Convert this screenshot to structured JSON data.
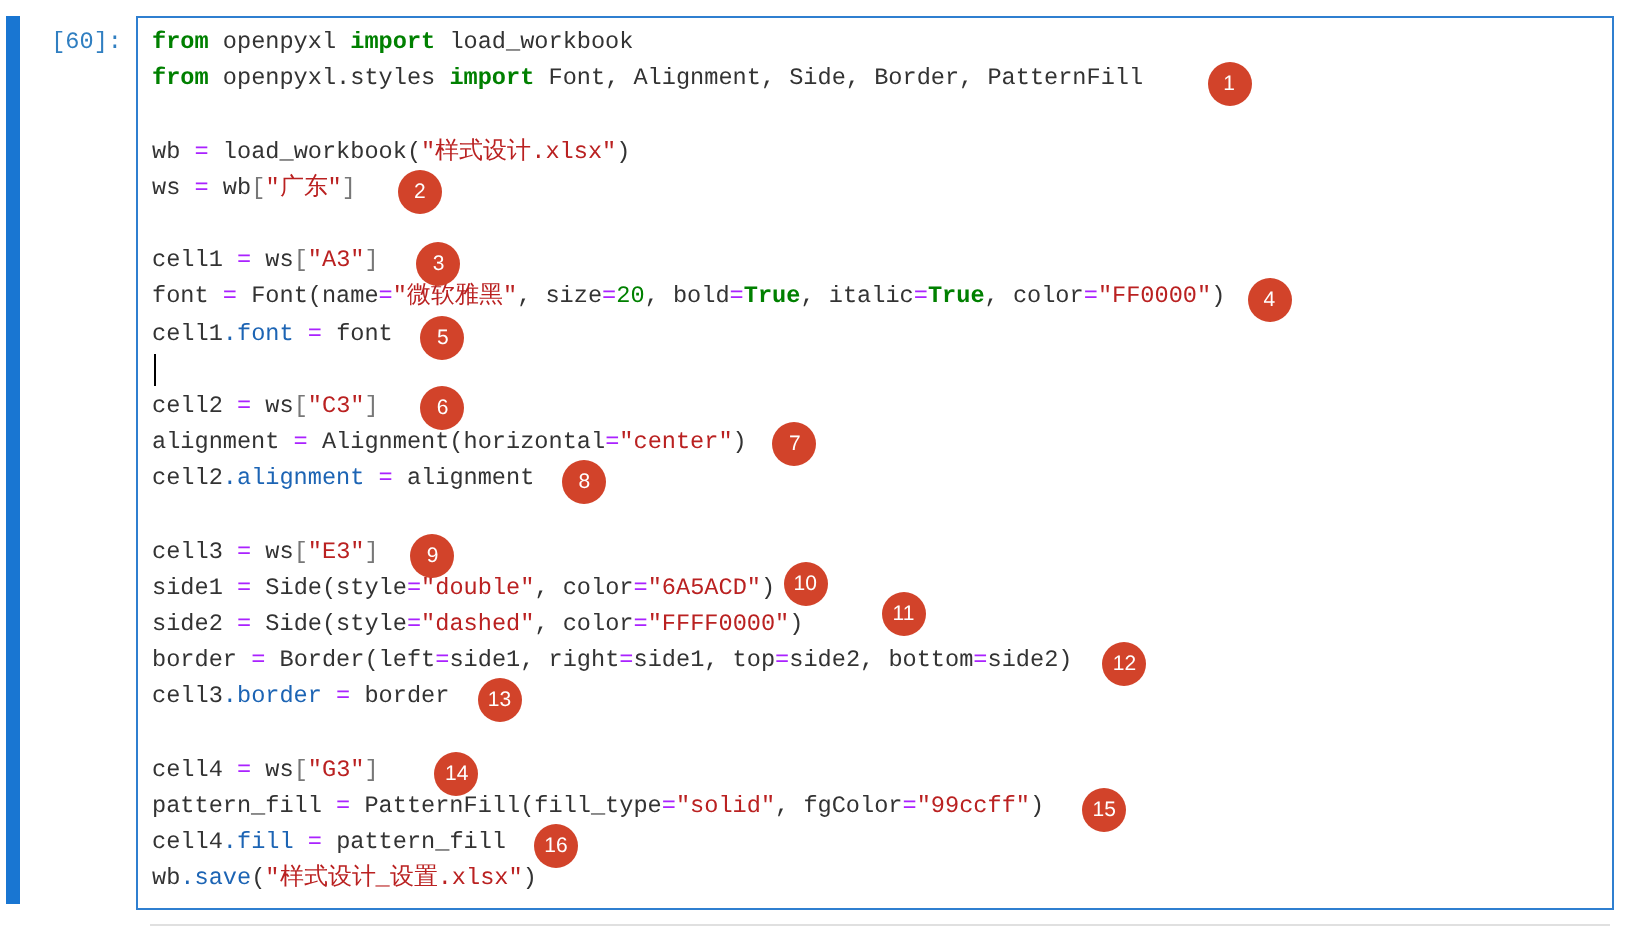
{
  "cell": {
    "prompt": "[60]:",
    "blocks": [
      {
        "lines": [
          {
            "tokens": [
              {
                "kind": "keyword",
                "text": "from"
              },
              {
                "kind": "plain",
                "text": " openpyxl "
              },
              {
                "kind": "keyword",
                "text": "import"
              },
              {
                "kind": "plain",
                "text": " load_workbook"
              }
            ]
          },
          {
            "tokens": [
              {
                "kind": "keyword",
                "text": "from"
              },
              {
                "kind": "plain",
                "text": " openpyxl.styles "
              },
              {
                "kind": "keyword",
                "text": "import"
              },
              {
                "kind": "plain",
                "text": " Font, Alignment, Side, Border, PatternFill"
              }
            ],
            "badge": "1"
          }
        ]
      },
      {
        "lines": [
          {
            "tokens": [
              {
                "kind": "plain",
                "text": "wb "
              },
              {
                "kind": "op",
                "text": "="
              },
              {
                "kind": "plain",
                "text": " load_workbook("
              },
              {
                "kind": "string",
                "text": "\"样式设计.xlsx\""
              },
              {
                "kind": "plain",
                "text": ")"
              }
            ]
          },
          {
            "tokens": [
              {
                "kind": "plain",
                "text": "ws "
              },
              {
                "kind": "op",
                "text": "="
              },
              {
                "kind": "plain",
                "text": " wb"
              },
              {
                "kind": "punct",
                "text": "["
              },
              {
                "kind": "string",
                "text": "\"广东\""
              },
              {
                "kind": "punct",
                "text": "]"
              }
            ],
            "badge": "2"
          }
        ]
      },
      {
        "lines": [
          {
            "tokens": [
              {
                "kind": "plain",
                "text": "cell1 "
              },
              {
                "kind": "op",
                "text": "="
              },
              {
                "kind": "plain",
                "text": " ws"
              },
              {
                "kind": "punct",
                "text": "["
              },
              {
                "kind": "string",
                "text": "\"A3\""
              },
              {
                "kind": "punct",
                "text": "]"
              }
            ],
            "badge": "3"
          },
          {
            "tokens": [
              {
                "kind": "plain",
                "text": "font "
              },
              {
                "kind": "op",
                "text": "="
              },
              {
                "kind": "plain",
                "text": " Font(name"
              },
              {
                "kind": "op",
                "text": "="
              },
              {
                "kind": "string",
                "text": "\"微软雅黑\""
              },
              {
                "kind": "plain",
                "text": ", size"
              },
              {
                "kind": "op",
                "text": "="
              },
              {
                "kind": "number",
                "text": "20"
              },
              {
                "kind": "plain",
                "text": ", bold"
              },
              {
                "kind": "op",
                "text": "="
              },
              {
                "kind": "keyword",
                "text": "True"
              },
              {
                "kind": "plain",
                "text": ", italic"
              },
              {
                "kind": "op",
                "text": "="
              },
              {
                "kind": "keyword",
                "text": "True"
              },
              {
                "kind": "plain",
                "text": ", color"
              },
              {
                "kind": "op",
                "text": "="
              },
              {
                "kind": "string",
                "text": "\"FF0000\""
              },
              {
                "kind": "plain",
                "text": ")"
              }
            ],
            "badge": "4"
          },
          {
            "tokens": [
              {
                "kind": "plain",
                "text": "cell1"
              },
              {
                "kind": "attr",
                "text": ".font"
              },
              {
                "kind": "op",
                "text": " = "
              },
              {
                "kind": "plain",
                "text": "font"
              }
            ],
            "badge": "5"
          },
          {
            "cursor": true
          }
        ]
      },
      {
        "lines": [
          {
            "tokens": [
              {
                "kind": "plain",
                "text": "cell2 "
              },
              {
                "kind": "op",
                "text": "="
              },
              {
                "kind": "plain",
                "text": " ws"
              },
              {
                "kind": "punct",
                "text": "["
              },
              {
                "kind": "string",
                "text": "\"C3\""
              },
              {
                "kind": "punct",
                "text": "]"
              }
            ],
            "badge": "6"
          },
          {
            "tokens": [
              {
                "kind": "plain",
                "text": "alignment "
              },
              {
                "kind": "op",
                "text": "="
              },
              {
                "kind": "plain",
                "text": " Alignment(horizontal"
              },
              {
                "kind": "op",
                "text": "="
              },
              {
                "kind": "string",
                "text": "\"center\""
              },
              {
                "kind": "plain",
                "text": ")"
              }
            ],
            "badge": "7"
          },
          {
            "tokens": [
              {
                "kind": "plain",
                "text": "cell2"
              },
              {
                "kind": "attr",
                "text": ".alignment"
              },
              {
                "kind": "op",
                "text": " = "
              },
              {
                "kind": "plain",
                "text": "alignment"
              }
            ],
            "badge": "8"
          }
        ]
      },
      {
        "lines": [
          {
            "tokens": [
              {
                "kind": "plain",
                "text": "cell3 "
              },
              {
                "kind": "op",
                "text": "="
              },
              {
                "kind": "plain",
                "text": " ws"
              },
              {
                "kind": "punct",
                "text": "["
              },
              {
                "kind": "string",
                "text": "\"E3\""
              },
              {
                "kind": "punct",
                "text": "]"
              }
            ],
            "badge": "9"
          },
          {
            "tokens": [
              {
                "kind": "plain",
                "text": "side1 "
              },
              {
                "kind": "op",
                "text": "="
              },
              {
                "kind": "plain",
                "text": " Side(style"
              },
              {
                "kind": "op",
                "text": "="
              },
              {
                "kind": "string",
                "text": "\"double\""
              },
              {
                "kind": "plain",
                "text": ", color"
              },
              {
                "kind": "op",
                "text": "="
              },
              {
                "kind": "string",
                "text": "\"6A5ACD\""
              },
              {
                "kind": "plain",
                "text": ")"
              }
            ],
            "badge": "10"
          },
          {
            "tokens": [
              {
                "kind": "plain",
                "text": "side2 "
              },
              {
                "kind": "op",
                "text": "="
              },
              {
                "kind": "plain",
                "text": " Side(style"
              },
              {
                "kind": "op",
                "text": "="
              },
              {
                "kind": "string",
                "text": "\"dashed\""
              },
              {
                "kind": "plain",
                "text": ", color"
              },
              {
                "kind": "op",
                "text": "="
              },
              {
                "kind": "string",
                "text": "\"FFFF0000\""
              },
              {
                "kind": "plain",
                "text": ")"
              }
            ],
            "badge": "11"
          },
          {
            "tokens": [
              {
                "kind": "plain",
                "text": "border "
              },
              {
                "kind": "op",
                "text": "="
              },
              {
                "kind": "plain",
                "text": " Border(left"
              },
              {
                "kind": "op",
                "text": "="
              },
              {
                "kind": "plain",
                "text": "side1, right"
              },
              {
                "kind": "op",
                "text": "="
              },
              {
                "kind": "plain",
                "text": "side1, top"
              },
              {
                "kind": "op",
                "text": "="
              },
              {
                "kind": "plain",
                "text": "side2, bottom"
              },
              {
                "kind": "op",
                "text": "="
              },
              {
                "kind": "plain",
                "text": "side2)"
              }
            ],
            "badge": "12"
          },
          {
            "tokens": [
              {
                "kind": "plain",
                "text": "cell3"
              },
              {
                "kind": "attr",
                "text": ".border"
              },
              {
                "kind": "op",
                "text": " = "
              },
              {
                "kind": "plain",
                "text": "border"
              }
            ],
            "badge": "13"
          }
        ]
      },
      {
        "lines": [
          {
            "tokens": [
              {
                "kind": "plain",
                "text": "cell4 "
              },
              {
                "kind": "op",
                "text": "="
              },
              {
                "kind": "plain",
                "text": " ws"
              },
              {
                "kind": "punct",
                "text": "["
              },
              {
                "kind": "string",
                "text": "\"G3\""
              },
              {
                "kind": "punct",
                "text": "]"
              }
            ],
            "badge": "14"
          },
          {
            "tokens": [
              {
                "kind": "plain",
                "text": "pattern_fill "
              },
              {
                "kind": "op",
                "text": "="
              },
              {
                "kind": "plain",
                "text": " PatternFill(fill_type"
              },
              {
                "kind": "op",
                "text": "="
              },
              {
                "kind": "string",
                "text": "\"solid\""
              },
              {
                "kind": "plain",
                "text": ", fgColor"
              },
              {
                "kind": "op",
                "text": "="
              },
              {
                "kind": "string",
                "text": "\"99ccff\""
              },
              {
                "kind": "plain",
                "text": ")"
              }
            ],
            "badge": "15"
          },
          {
            "tokens": [
              {
                "kind": "plain",
                "text": "cell4"
              },
              {
                "kind": "attr",
                "text": ".fill"
              },
              {
                "kind": "op",
                "text": " = "
              },
              {
                "kind": "plain",
                "text": "pattern_fill"
              }
            ],
            "badge": "16"
          },
          {
            "tokens": [
              {
                "kind": "plain",
                "text": "wb"
              },
              {
                "kind": "attr",
                "text": ".save"
              },
              {
                "kind": "plain",
                "text": "("
              },
              {
                "kind": "string",
                "text": "\"样式设计_设置.xlsx\""
              },
              {
                "kind": "plain",
                "text": ")"
              }
            ]
          }
        ]
      }
    ]
  }
}
